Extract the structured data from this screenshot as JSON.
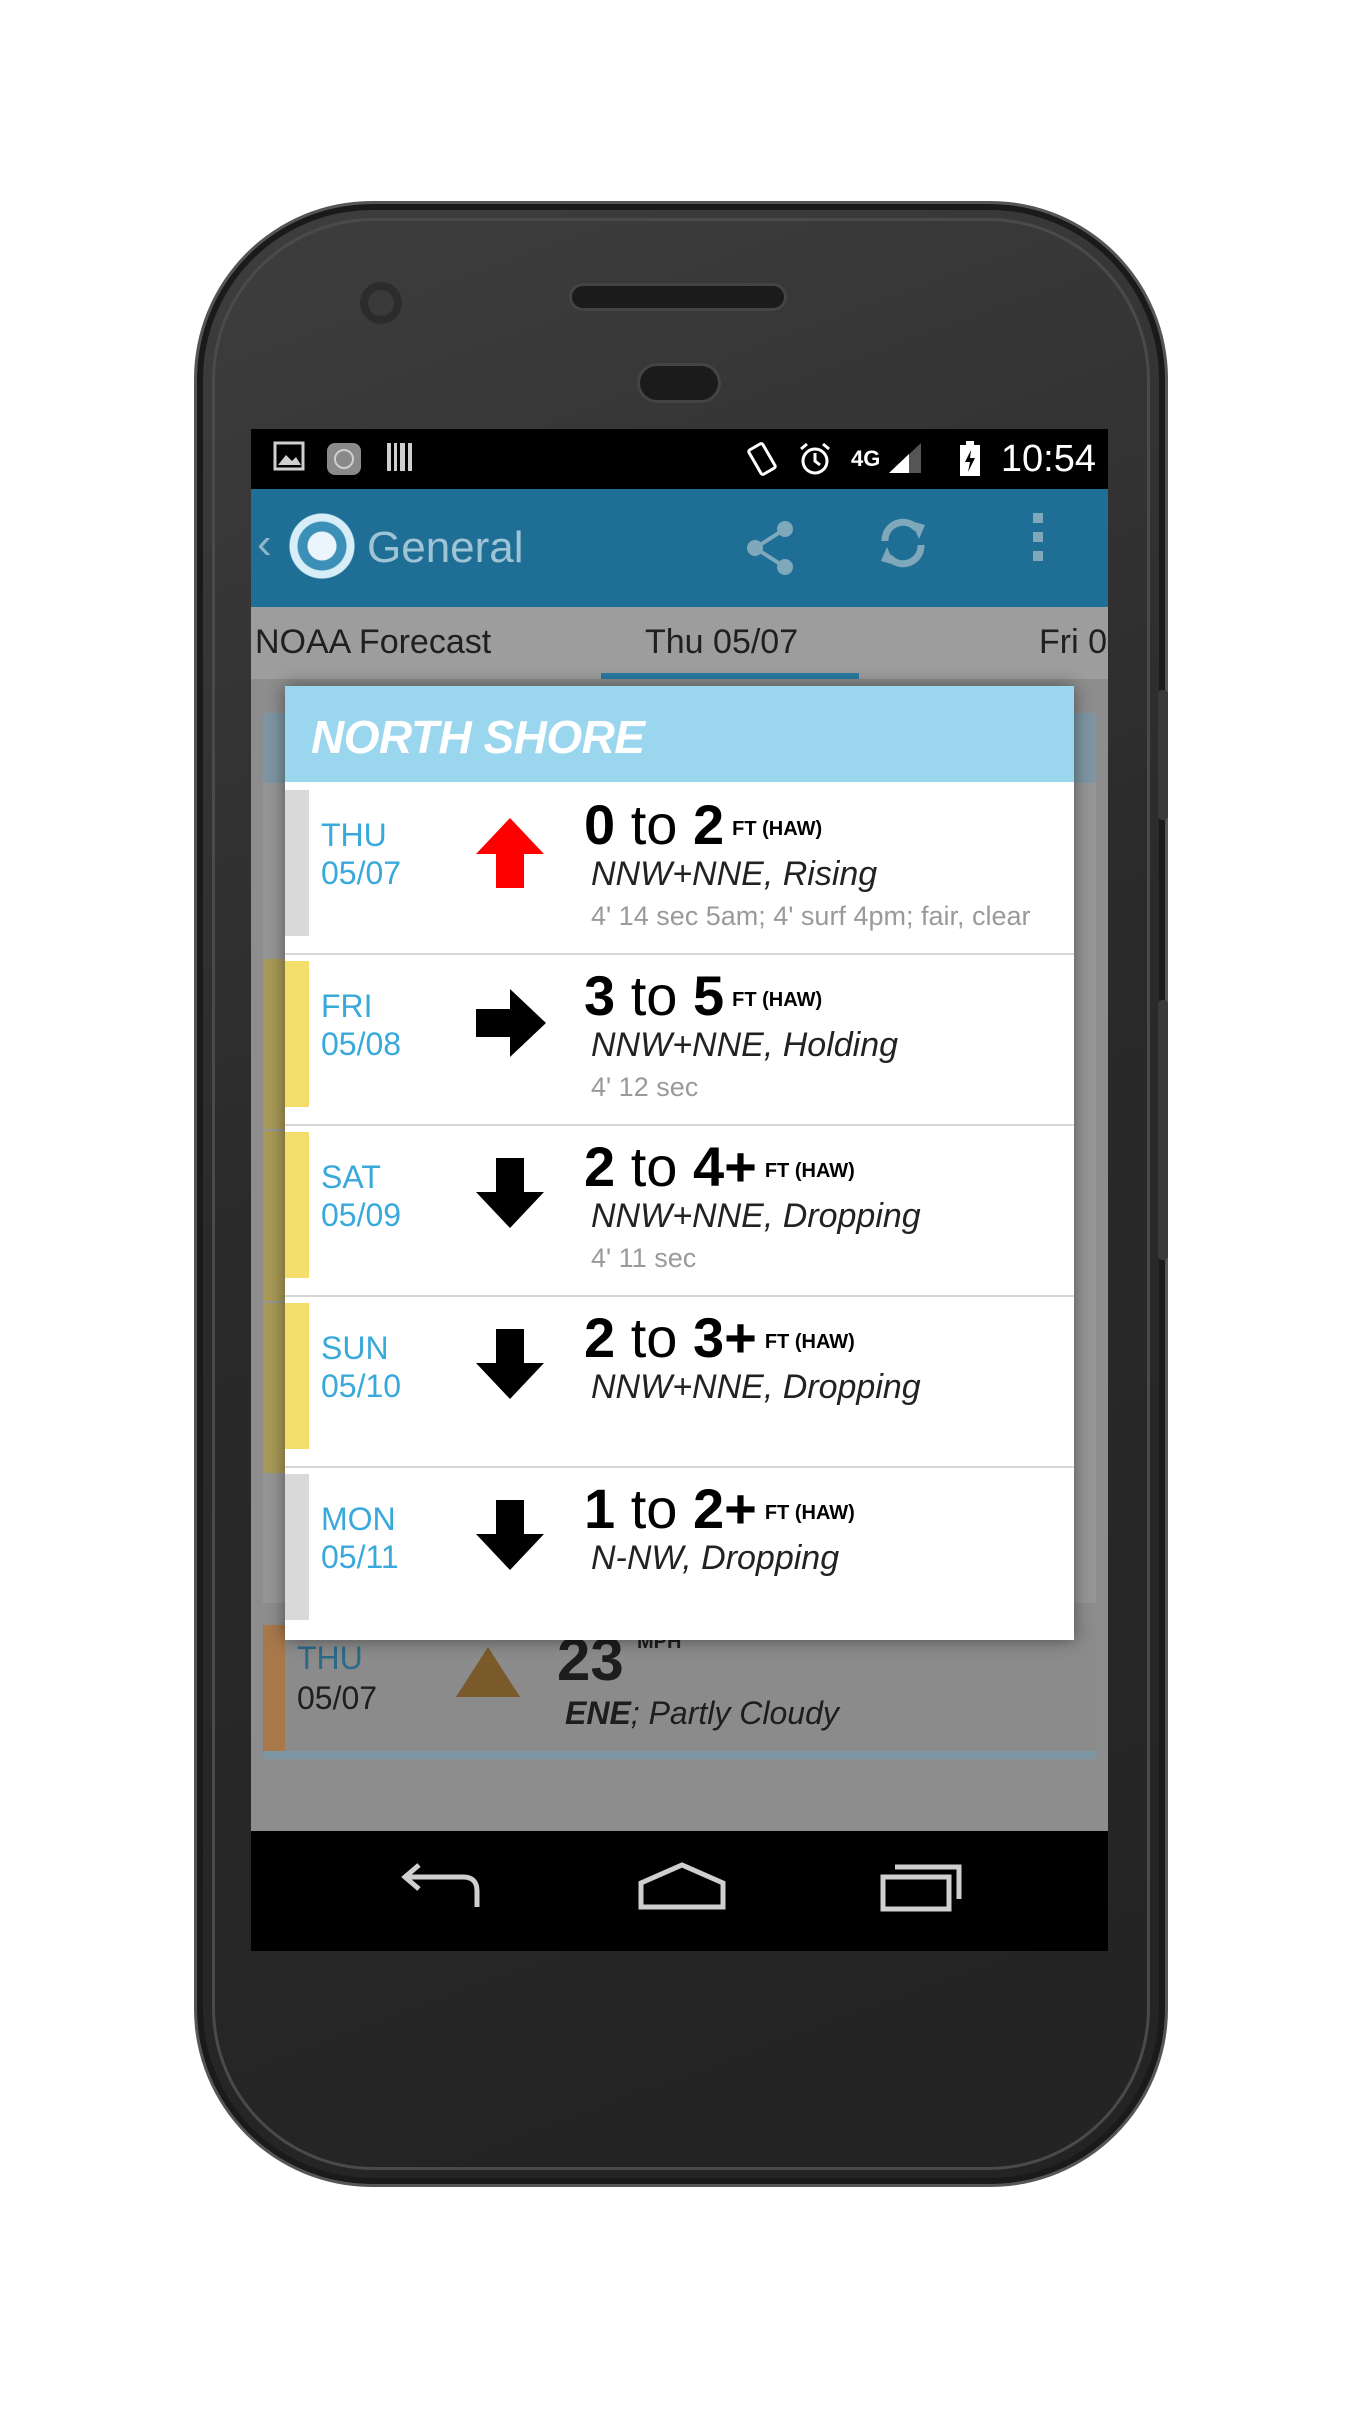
{
  "status_bar": {
    "time": "10:54",
    "network": "4G",
    "icons": [
      "image-icon",
      "app-icon",
      "barcode-icon",
      "vibrate-icon",
      "alarm-icon",
      "signal-icon",
      "battery-icon"
    ]
  },
  "action_bar": {
    "title": "General",
    "icons": [
      "back-icon",
      "app-logo",
      "share-icon",
      "refresh-icon",
      "overflow-menu-icon"
    ]
  },
  "tabs": [
    {
      "label": "NOAA Forecast"
    },
    {
      "label": "Thu 05/07"
    },
    {
      "label": "Fri 0"
    }
  ],
  "dialog": {
    "title": "NORTH SHORE",
    "rows": [
      {
        "day": "THU",
        "date": "05/07",
        "arrow": "up",
        "arrow_color": "#ff0000",
        "range_low": "0",
        "range_mid": "to",
        "range_high": "2",
        "unit": "FT (HAW)",
        "swell": "NNW+NNE, Rising",
        "detail": "4' 14 sec 5am; 4' surf 4pm; fair, clear",
        "strip_color": "#d9d9d9"
      },
      {
        "day": "FRI",
        "date": "05/08",
        "arrow": "right",
        "arrow_color": "#000000",
        "range_low": "3",
        "range_mid": "to",
        "range_high": "5",
        "unit": "FT (HAW)",
        "swell": "NNW+NNE, Holding",
        "detail": "4' 12 sec",
        "strip_color": "#f4de6b"
      },
      {
        "day": "SAT",
        "date": "05/09",
        "arrow": "down",
        "arrow_color": "#000000",
        "range_low": "2",
        "range_mid": "to",
        "range_high": "4+",
        "unit": "FT (HAW)",
        "swell": "NNW+NNE, Dropping",
        "detail": "4' 11 sec",
        "strip_color": "#f4de6b"
      },
      {
        "day": "SUN",
        "date": "05/10",
        "arrow": "down",
        "arrow_color": "#000000",
        "range_low": "2",
        "range_mid": "to",
        "range_high": "3+",
        "unit": "FT (HAW)",
        "swell": "NNW+NNE, Dropping",
        "detail": "",
        "strip_color": "#f4de6b"
      },
      {
        "day": "MON",
        "date": "05/11",
        "arrow": "down",
        "arrow_color": "#000000",
        "range_low": "1",
        "range_mid": "to",
        "range_high": "2+",
        "unit": "FT (HAW)",
        "swell": "N-NW, Dropping",
        "detail": "",
        "strip_color": "#d9d9d9"
      }
    ]
  },
  "background_wind": {
    "day": "THU",
    "date": "05/07",
    "speed": "23",
    "unit": "MPH",
    "direction": "ENE",
    "conditions": "; Partly Cloudy"
  },
  "nav_bar": {
    "icons": [
      "back-nav-icon",
      "home-nav-icon",
      "recents-nav-icon"
    ]
  }
}
